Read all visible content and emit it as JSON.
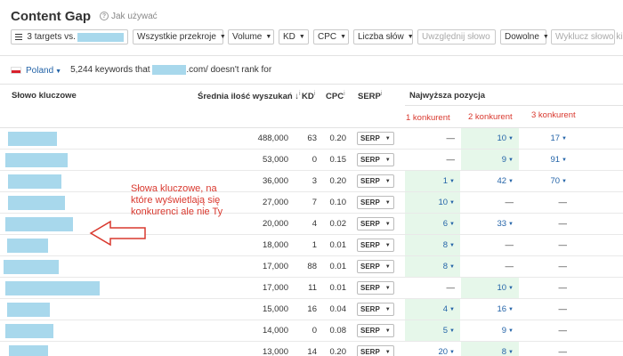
{
  "page": {
    "title": "Content Gap",
    "help_label": "Jak używać",
    "help_icon": "question-icon"
  },
  "filters": {
    "targets_label": "3 targets vs.",
    "intersect_label": "Wszystkie przekroje",
    "volume_label": "Volume",
    "kd_label": "KD",
    "cpc_label": "CPC",
    "words_label": "Liczba słów",
    "include_placeholder": "Uwzględnij słowo",
    "mode_label": "Dowolne",
    "exclude_placeholder": "Wyklucz słowo ki"
  },
  "country": {
    "name": "Poland",
    "keywords_text_prefix": "5,244 keywords that",
    "keywords_text_suffix": ".com/ doesn't rank for"
  },
  "table": {
    "headers": {
      "keyword": "Słowo kluczowe",
      "volume": "Średnia ilość wyszukań",
      "volume_sort": "↓",
      "kd": "KD",
      "cpc": "CPC",
      "serp": "SERP",
      "top_position": "Najwyższa pozycja"
    },
    "competitors": [
      "1 konkurent",
      "2 konkurent",
      "3 konkurent"
    ],
    "serp_label": "SERP",
    "rows": [
      {
        "volume": "488,000",
        "kd": "63",
        "cpc": "0.20",
        "p1": "—",
        "p2": "10",
        "p3": "17",
        "hl": 2
      },
      {
        "volume": "53,000",
        "kd": "0",
        "cpc": "0.15",
        "p1": "—",
        "p2": "9",
        "p3": "91",
        "hl": 2
      },
      {
        "volume": "36,000",
        "kd": "3",
        "cpc": "0.20",
        "p1": "1",
        "p2": "42",
        "p3": "70",
        "hl": 1
      },
      {
        "volume": "27,000",
        "kd": "7",
        "cpc": "0.10",
        "p1": "10",
        "p2": "—",
        "p3": "—",
        "hl": 1
      },
      {
        "volume": "20,000",
        "kd": "4",
        "cpc": "0.02",
        "p1": "6",
        "p2": "33",
        "p3": "—",
        "hl": 1
      },
      {
        "volume": "18,000",
        "kd": "1",
        "cpc": "0.01",
        "p1": "8",
        "p2": "—",
        "p3": "—",
        "hl": 1
      },
      {
        "volume": "17,000",
        "kd": "88",
        "cpc": "0.01",
        "p1": "8",
        "p2": "—",
        "p3": "—",
        "hl": 1
      },
      {
        "volume": "17,000",
        "kd": "11",
        "cpc": "0.01",
        "p1": "—",
        "p2": "10",
        "p3": "—",
        "hl": 2
      },
      {
        "volume": "15,000",
        "kd": "16",
        "cpc": "0.04",
        "p1": "4",
        "p2": "16",
        "p3": "—",
        "hl": 1
      },
      {
        "volume": "14,000",
        "kd": "0",
        "cpc": "0.08",
        "p1": "5",
        "p2": "9",
        "p3": "—",
        "hl": 1
      },
      {
        "volume": "13,000",
        "kd": "14",
        "cpc": "0.20",
        "p1": "20",
        "p2": "8",
        "p3": "—",
        "hl": 2
      }
    ]
  },
  "annotation": {
    "text": "Słowa kluczowe, na które wyświetlają się konkurenci ale nie Ty"
  },
  "colors": {
    "accent_blue": "#2464a8",
    "annotation_red": "#d9382e",
    "highlight_green": "#e6f7ea",
    "redaction": "#a8d8ec"
  }
}
